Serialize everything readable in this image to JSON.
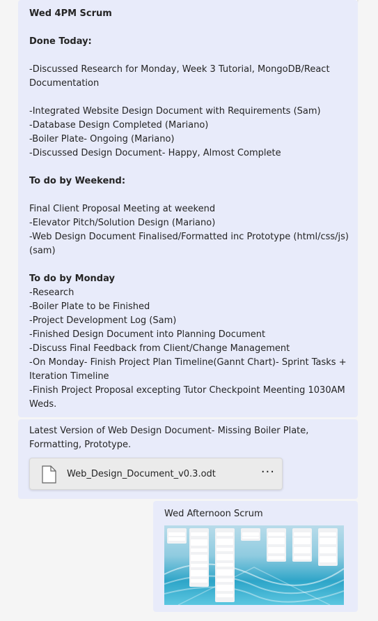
{
  "scrum_message": {
    "lines": [
      {
        "text": "Wed 4PM Scrum",
        "bold": true
      },
      {
        "text": "",
        "bold": false
      },
      {
        "text": "Done Today:",
        "bold": true
      },
      {
        "text": "",
        "bold": false
      },
      {
        "text": "-Discussed Research for Monday, Week 3 Tutorial, MongoDB/React",
        "bold": false
      },
      {
        "text": "Documentation",
        "bold": false
      },
      {
        "text": "",
        "bold": false
      },
      {
        "text": "-Integrated Website Design Document with Requirements (Sam)",
        "bold": false
      },
      {
        "text": "-Database Design Completed (Mariano)",
        "bold": false
      },
      {
        "text": "-Boiler Plate- Ongoing (Mariano)",
        "bold": false
      },
      {
        "text": "-Discussed Design Document- Happy, Almost Complete",
        "bold": false
      },
      {
        "text": "",
        "bold": false
      },
      {
        "text": "To do by Weekend:",
        "bold": true
      },
      {
        "text": "",
        "bold": false
      },
      {
        "text": "Final Client Proposal Meeting at weekend",
        "bold": false
      },
      {
        "text": "-Elevator Pitch/Solution Design (Mariano)",
        "bold": false
      },
      {
        "text": "-Web Design Document Finalised/Formatted inc Prototype (html/css/js)",
        "bold": false
      },
      {
        "text": "(sam)",
        "bold": false
      },
      {
        "text": "",
        "bold": false
      },
      {
        "text": "To do by Monday",
        "bold": true
      },
      {
        "text": "-Research",
        "bold": false
      },
      {
        "text": "-Boiler Plate to be Finished",
        "bold": false
      },
      {
        "text": "-Project Development Log (Sam)",
        "bold": false
      },
      {
        "text": "-Finished Design Document into Planning Document",
        "bold": false
      },
      {
        "text": "-Discuss Final Feedback from Client/Change Management",
        "bold": false
      },
      {
        "text": "-On Monday- Finish Project Plan Timeline(Gannt Chart)- Sprint Tasks +",
        "bold": false
      },
      {
        "text": "Iteration Timeline",
        "bold": false
      },
      {
        "text": "-Finish Project Proposal excepting Tutor Checkpoint Meenting 1030AM",
        "bold": false
      },
      {
        "text": "Weds.",
        "bold": false
      }
    ]
  },
  "file_message": {
    "text_lines": [
      "Latest Version of Web Design Document- Missing Boiler Plate,",
      "Formatting, Prototype."
    ],
    "attachment": {
      "icon": "document-icon",
      "filename": "Web_Design_Document_v0.3.odt",
      "more_label": "···"
    }
  },
  "image_message": {
    "caption": "Wed Afternoon Scrum",
    "image_description_icon": "board-screenshot-image"
  },
  "colors": {
    "bubble": "#e8ebfa",
    "background": "#f5f5f5"
  }
}
